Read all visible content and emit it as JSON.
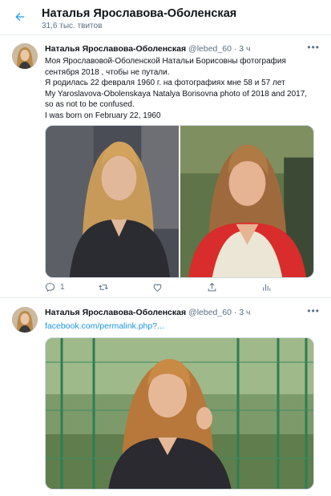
{
  "header": {
    "title": "Наталья Ярославова-Оболенская",
    "subtitle": "31,6 тыс. твитов"
  },
  "tweets": [
    {
      "name": "Наталья Ярославова-Оболенская",
      "handle": "@lebed_60",
      "separator": "·",
      "time": "3 ч",
      "lines": [
        "Моя Ярославовой-Оболенской Натальи Борисовны  фотография",
        "сентября 2018 , чтобы не путали.",
        "Я родилась 22 февраля 1960 г. на фотографиях мне 58 и 57 лет",
        "My Yaroslavova-Obolenskaya Natalya Borisovna photo of  2018 and 2017,",
        "so as not to be confused.",
        "I was born on February 22, 1960"
      ],
      "reply_count": "1"
    },
    {
      "name": "Наталья Ярославова-Оболенская",
      "handle": "@lebed_60",
      "separator": "·",
      "time": "3 ч",
      "link": "facebook.com/permalink.php?..."
    }
  ],
  "colors": {
    "accent": "#1da1f2",
    "link": "#1b95e0",
    "secondary_text": "#5b7083",
    "divider": "#e6ecf0"
  },
  "icons": [
    "back-arrow-icon",
    "more-icon",
    "reply-icon",
    "retweet-icon",
    "like-icon",
    "share-icon",
    "analytics-icon"
  ]
}
